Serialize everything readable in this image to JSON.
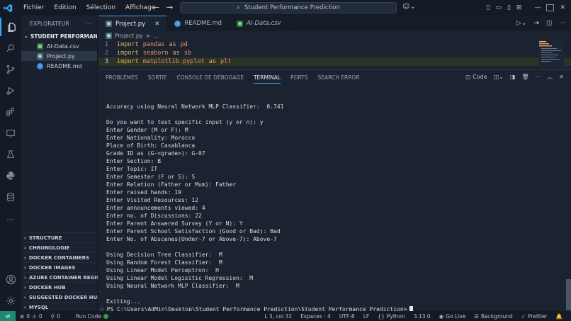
{
  "titlebar": {
    "menu": [
      "Fichier",
      "Edition",
      "Sélection",
      "Affichage"
    ],
    "more": "···",
    "search": "Student Performance Prediction"
  },
  "explorer": {
    "title": "EXPLORATEUR",
    "more": "···",
    "folder": "STUDENT PERFORMANCE ...",
    "files": [
      {
        "name": "AI-Data.csv",
        "icon": "csv-file-icon"
      },
      {
        "name": "Project.py",
        "icon": "python-file-icon"
      },
      {
        "name": "README.md",
        "icon": "info-file-icon"
      }
    ],
    "sections": [
      "STRUCTURE",
      "CHRONOLOGIE",
      "DOCKER CONTAINERS",
      "DOCKER IMAGES",
      "AZURE CONTAINER REGIS...",
      "DOCKER HUB",
      "SUGGESTED DOCKER HUB ...",
      "MYSQL"
    ]
  },
  "tabs": [
    {
      "label": "Project.py",
      "active": true
    },
    {
      "label": "README.md",
      "active": false
    },
    {
      "label": "AI-Data.csv",
      "active": false
    }
  ],
  "editor": {
    "breadcrumb": [
      "Project.py",
      ">",
      "..."
    ],
    "lines": [
      {
        "num": "1",
        "kw": "import",
        "mod": "pandas",
        "as": "as",
        "alias": "pd"
      },
      {
        "num": "2",
        "kw": "import",
        "mod": "seaborn",
        "as": "as",
        "alias": "sb"
      },
      {
        "num": "3",
        "kw": "import",
        "mod": "matplotlib.pyplot",
        "as": "as",
        "alias": "plt"
      }
    ]
  },
  "panel": {
    "tabs": [
      "PROBLÈMES",
      "SORTIE",
      "CONSOLE DE DÉBOGAGE",
      "TERMINAL",
      "PORTS",
      "SEARCH ERROR"
    ],
    "active_tab": "TERMINAL",
    "code_label": "Code"
  },
  "terminal": {
    "lines": [
      "Accuracy using Neural Network MLP Classifier:  0.741",
      "",
      "Do you want to test specific input (y or n): y",
      "Enter Gender (M or F): M",
      "Enter Nationality: Morocco",
      "Place of Birth: Casablanca",
      "Grade ID as (G-<grade>): G-07",
      "Enter Section: B",
      "Enter Topic: IT",
      "Enter Semester (F or S): S",
      "Enter Relation (Father or Mum): Father",
      "Enter raised hands: 19",
      "Enter Visited Resources: 12",
      "Enter announcements viewed: 4",
      "Enter no. of Discussions: 22",
      "Enter Parent Answered Survey (Y or N): Y",
      "Enter Parent School Satisfaction (Good or Bad): Bad",
      "Enter No. of Abscenes(Under-7 or Above-7): Above-7",
      "",
      "Using Decision Tree Classifier:  M",
      "Using Random Forest Classifier:  M",
      "Using Linear Model Perceptron:  H",
      "Using Linear Model Logisitic Regression:  M",
      "Using Neural Network MLP Classifier:  M",
      "",
      "Exiting..."
    ],
    "prompt": "PS C:\\Users\\AdMin\\Desktop\\Student Performance Prediction\\Student Performance Prediction>"
  },
  "statusbar": {
    "errors": "0",
    "warnings": "0",
    "ports": "0",
    "run": "Run Code",
    "position": "L 3, col 32",
    "spaces": "Espaces : 4",
    "encoding": "UTF-8",
    "eol": "LF",
    "language": "Python",
    "version": "3.13.0",
    "golive": "Go Live",
    "background": "Background",
    "prettier": "Prettier"
  }
}
